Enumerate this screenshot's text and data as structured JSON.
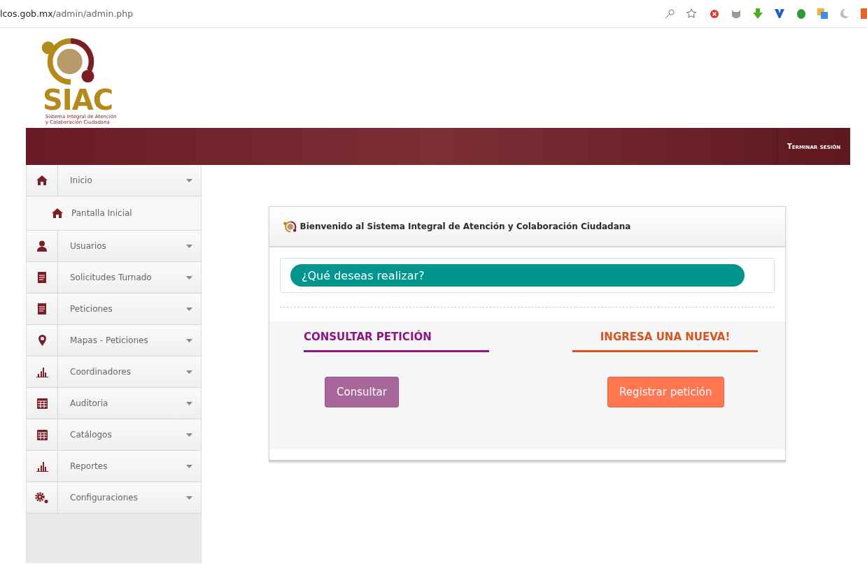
{
  "browser": {
    "url_domain": "lcos.gob.mx",
    "url_path": "/admin/admin.php"
  },
  "logo": {
    "title": "SIAC",
    "subtitle_lines": [
      "Sistema Integral de Atención",
      "y Colaboración Ciudadana"
    ]
  },
  "header": {
    "logout": "Terminar sesión"
  },
  "sidebar": {
    "items": [
      {
        "label": "Inicio",
        "kind": "home",
        "children": [
          {
            "label": "Pantalla Inicial",
            "kind": "home"
          }
        ]
      },
      {
        "label": "Usuarios",
        "kind": "user"
      },
      {
        "label": "Solicitudes Turnado",
        "kind": "doc"
      },
      {
        "label": "Peticiones",
        "kind": "doc"
      },
      {
        "label": "Mapas - Peticiones",
        "kind": "pin"
      },
      {
        "label": "Coordinadores",
        "kind": "bars"
      },
      {
        "label": "Auditoria",
        "kind": "table"
      },
      {
        "label": "Catálogos",
        "kind": "table"
      },
      {
        "label": "Reportes",
        "kind": "bars"
      },
      {
        "label": "Configuraciones",
        "kind": "gears"
      }
    ]
  },
  "card": {
    "title": "Bienvenido al Sistema Integral de Atención y Colaboración Ciudadana",
    "question": "¿Qué deseas realizar?",
    "sections": [
      {
        "heading": "CONSULTAR PETICIÓN",
        "color": "#8e1584",
        "button": "Consultar"
      },
      {
        "heading": "INGRESA UNA NUEVA!",
        "color": "#d9531e",
        "button": "Registrar petición"
      }
    ]
  }
}
